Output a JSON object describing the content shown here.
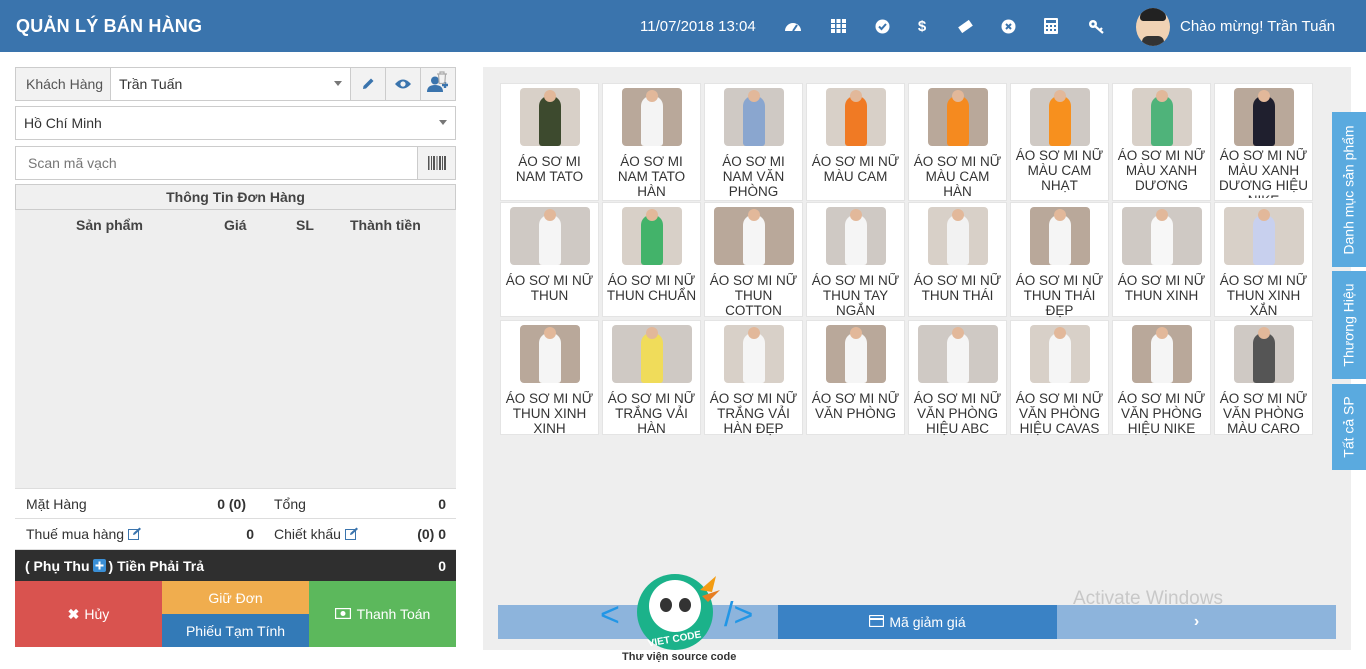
{
  "header": {
    "title": "QUẢN LÝ BÁN HÀNG",
    "datetime": "11/07/2018 13:04",
    "icons": [
      "dashboard-icon",
      "grid-icon",
      "check-circle-icon",
      "dollar-icon",
      "ticket-icon",
      "close-circle-icon",
      "calculator-icon",
      "key-icon"
    ],
    "welcome": "Chào mừng! Trần Tuấn"
  },
  "customer": {
    "label": "Khách Hàng",
    "value": "Trần Tuấn"
  },
  "city": {
    "value": "Hồ Chí Minh"
  },
  "scan": {
    "placeholder": "Scan mã vạch"
  },
  "order": {
    "title": "Thông Tin Đơn Hàng",
    "columns": {
      "product": "Sản phẩm",
      "price": "Giá",
      "qty": "SL",
      "amount": "Thành tiền"
    }
  },
  "summary": {
    "items_label": "Mặt Hàng",
    "items_value": "0 (0)",
    "total_label": "Tổng",
    "total_value": "0",
    "tax_label": "Thuế mua hàng",
    "tax_value": "0",
    "discount_label": "Chiết khấu",
    "discount_value": "(0) 0",
    "surcharge_label": "( Phụ Thu",
    "surcharge_after": ") Tiền Phải Trả",
    "payable_value": "0"
  },
  "actions": {
    "cancel": "Hủy",
    "hold": "Giữ Đơn",
    "temp": "Phiếu Tạm Tính",
    "pay": "Thanh Toán"
  },
  "products": [
    {
      "name": "ÁO SƠ MI NAM TATO",
      "color": "#3d4a2e"
    },
    {
      "name": "ÁO SƠ MI NAM TATO HÀN",
      "color": "#f4f4f4"
    },
    {
      "name": "ÁO SƠ MI NAM VĂN PHÒNG",
      "color": "#8aa6cf"
    },
    {
      "name": "ÁO SƠ MI NỮ MÀU CAM",
      "color": "#f07a24"
    },
    {
      "name": "ÁO SƠ MI NỮ MÀU CAM HÀN",
      "color": "#f58a1f"
    },
    {
      "name": "ÁO SƠ MI NỮ MÀU CAM NHẠT",
      "color": "#f7901e"
    },
    {
      "name": "ÁO SƠ MI NỮ MÀU XANH DƯƠNG",
      "color": "#4fb37a"
    },
    {
      "name": "ÁO SƠ MI NỮ MÀU XANH DƯƠNG HIỆU NIKE",
      "color": "#1f1f2e"
    },
    {
      "name": "ÁO SƠ MI NỮ THUN",
      "color": "#f5f5f5"
    },
    {
      "name": "ÁO SƠ MI NỮ THUN CHUẨN",
      "color": "#43b36a"
    },
    {
      "name": "ÁO SƠ MI NỮ THUN COTTON",
      "color": "#f5f5f5"
    },
    {
      "name": "ÁO SƠ MI NỮ THUN TAY NGẮN",
      "color": "#f5f5f5"
    },
    {
      "name": "ÁO SƠ MI NỮ THUN THÁI",
      "color": "#f2f2f2"
    },
    {
      "name": "ÁO SƠ MI NỮ THUN THÁI ĐẸP",
      "color": "#f5f5f5"
    },
    {
      "name": "ÁO SƠ MI NỮ THUN XINH",
      "color": "#f7f7f7"
    },
    {
      "name": "ÁO SƠ MI NỮ THUN XINH XẮN",
      "color": "#c8d0ee"
    },
    {
      "name": "ÁO SƠ MI NỮ THUN XINH XINH",
      "color": "#f5f5f5"
    },
    {
      "name": "ÁO SƠ MI NỮ TRẮNG VẢI HÀN",
      "color": "#f0dc5a"
    },
    {
      "name": "ÁO SƠ MI NỮ TRẮNG VẢI HÀN ĐẸP",
      "color": "#f5f5f5"
    },
    {
      "name": "ÁO SƠ MI NỮ VĂN PHÒNG",
      "color": "#f5f5f5"
    },
    {
      "name": "ÁO SƠ MI NỮ VĂN PHÒNG HIỆU ABC",
      "color": "#f5f5f5"
    },
    {
      "name": "ÁO SƠ MI NỮ VĂN PHÒNG HIỆU CAVAS",
      "color": "#f5f5f5"
    },
    {
      "name": "ÁO SƠ MI NỮ VĂN PHÒNG HIỆU NIKE",
      "color": "#f5f5f5"
    },
    {
      "name": "ÁO SƠ MI NỮ VĂN PHÒNG MÀU CARO",
      "color": "#555555"
    }
  ],
  "bottom": {
    "coupon": "Mã giảm giá"
  },
  "side_tabs": {
    "categories": "Danh mục sản phẩm",
    "brands": "Thương Hiệu",
    "all": "Tất cả SP"
  },
  "overlay": {
    "watermark": "Activate Windows",
    "logo_text": "VIET CODE",
    "logo_caption": "Thư viện source code"
  },
  "colors": {
    "header": "#3a74ad",
    "cancel": "#d9534f",
    "hold": "#f0ad4e",
    "temp": "#337ab7",
    "pay": "#5cb85c",
    "side_tab": "#5aaadf"
  }
}
